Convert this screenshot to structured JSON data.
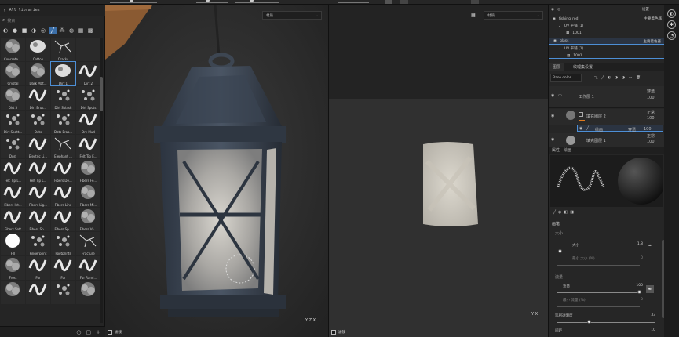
{
  "library": {
    "path_label": "All libraries",
    "search_placeholder": "搜索",
    "items": [
      {
        "label": "Concrete ...",
        "style": "noise"
      },
      {
        "label": "Cotton",
        "style": "blob"
      },
      {
        "label": "Cracks",
        "style": "crack"
      },
      {
        "label": "",
        "style": "empty"
      },
      {
        "label": "Crystal",
        "style": "noise"
      },
      {
        "label": "Dark Mat...",
        "style": "noise"
      },
      {
        "label": "Dirt 1",
        "style": "blob",
        "selected": true
      },
      {
        "label": "Dirt 2",
        "style": "wave"
      },
      {
        "label": "Dirt 3",
        "style": "noise"
      },
      {
        "label": "Dirt Brus...",
        "style": "wave"
      },
      {
        "label": "Dirt Splash",
        "style": "dots"
      },
      {
        "label": "Dirt Spots",
        "style": "dots"
      },
      {
        "label": "Dirt Spott...",
        "style": "dots"
      },
      {
        "label": "Dots",
        "style": "dots"
      },
      {
        "label": "Dots Eras...",
        "style": "dots"
      },
      {
        "label": "Dry Mud",
        "style": "wave"
      },
      {
        "label": "Dust",
        "style": "dots"
      },
      {
        "label": "Electric Li...",
        "style": "wave"
      },
      {
        "label": "Elephant ...",
        "style": "crack"
      },
      {
        "label": "Felt Tip E...",
        "style": "wave"
      },
      {
        "label": "Felt Tip L...",
        "style": "wave"
      },
      {
        "label": "Felt Tip L...",
        "style": "wave"
      },
      {
        "label": "Fibers De...",
        "style": "wave"
      },
      {
        "label": "Fibers Fe...",
        "style": "noise"
      },
      {
        "label": "Fibers Int...",
        "style": "wave"
      },
      {
        "label": "Fibers Lig...",
        "style": "wave"
      },
      {
        "label": "Fibers Line",
        "style": "wave"
      },
      {
        "label": "Fibers Mi...",
        "style": "noise"
      },
      {
        "label": "Fibers Soft",
        "style": "wave"
      },
      {
        "label": "Fibers Sp...",
        "style": "wave"
      },
      {
        "label": "Fibers Sp...",
        "style": "wave"
      },
      {
        "label": "Fibers Va...",
        "style": "noise"
      },
      {
        "label": "Fill",
        "style": "fill"
      },
      {
        "label": "Fingerprint",
        "style": "dots"
      },
      {
        "label": "Footprints",
        "style": "dots"
      },
      {
        "label": "Fracture",
        "style": "crack"
      },
      {
        "label": "Frost",
        "style": "noise"
      },
      {
        "label": "Fur",
        "style": "wave"
      },
      {
        "label": "Fur",
        "style": "wave"
      },
      {
        "label": "Fur Rand...",
        "style": "wave"
      },
      {
        "label": "",
        "style": "noise"
      },
      {
        "label": "",
        "style": "wave"
      },
      {
        "label": "",
        "style": "dots"
      },
      {
        "label": "",
        "style": "noise"
      }
    ]
  },
  "viewport3d": {
    "dropdown": "材质",
    "footer": "滤镜",
    "axis": "Y Z X"
  },
  "viewport2d": {
    "dropdown": "材质",
    "footer": "滤镜",
    "axis": "Y X"
  },
  "top_dropdown": "设置",
  "texture_sets": [
    {
      "name": "fishing_rod",
      "shader": "主要着色器",
      "uv": "UV 平铺 (1)",
      "tile": "1001"
    },
    {
      "name": "glass",
      "shader": "主要着色器",
      "uv": "UV 平铺 (1)",
      "tile": "1001"
    }
  ],
  "layers_panel": {
    "tab_layers": "图层",
    "tab_texset": "纹理集设置",
    "channel": "Base color",
    "layers": [
      {
        "name": "工作层 1",
        "blend": "穿透",
        "opacity": "100"
      },
      {
        "name": "填充图层 2",
        "blend": "正常",
        "opacity": "100"
      },
      {
        "name": "绘画",
        "blend": "穿透",
        "opacity": "100"
      },
      {
        "name": "填充图层 1",
        "blend": "正常",
        "opacity": "100"
      }
    ]
  },
  "properties": {
    "title": "属性 - 绘画",
    "section": "画笔",
    "size_group": "大小",
    "size_label": "大小",
    "size_value": "1.8",
    "min_size_label": "最小 大小 (%)",
    "min_size_value": "0",
    "flow_group": "流量",
    "flow_label": "流量",
    "flow_value": "100",
    "min_flow_label": "最小 流量 (%)",
    "min_flow_value": "0",
    "stroke_opacity_label": "笔刷透明度",
    "stroke_opacity_value": "33",
    "spacing_label": "间距",
    "spacing_value": "10",
    "levels": {
      "size": 0.05,
      "min_size": 0.0,
      "flow": 1.0,
      "min_flow": 0.0,
      "stroke_opacity": 0.33
    }
  }
}
